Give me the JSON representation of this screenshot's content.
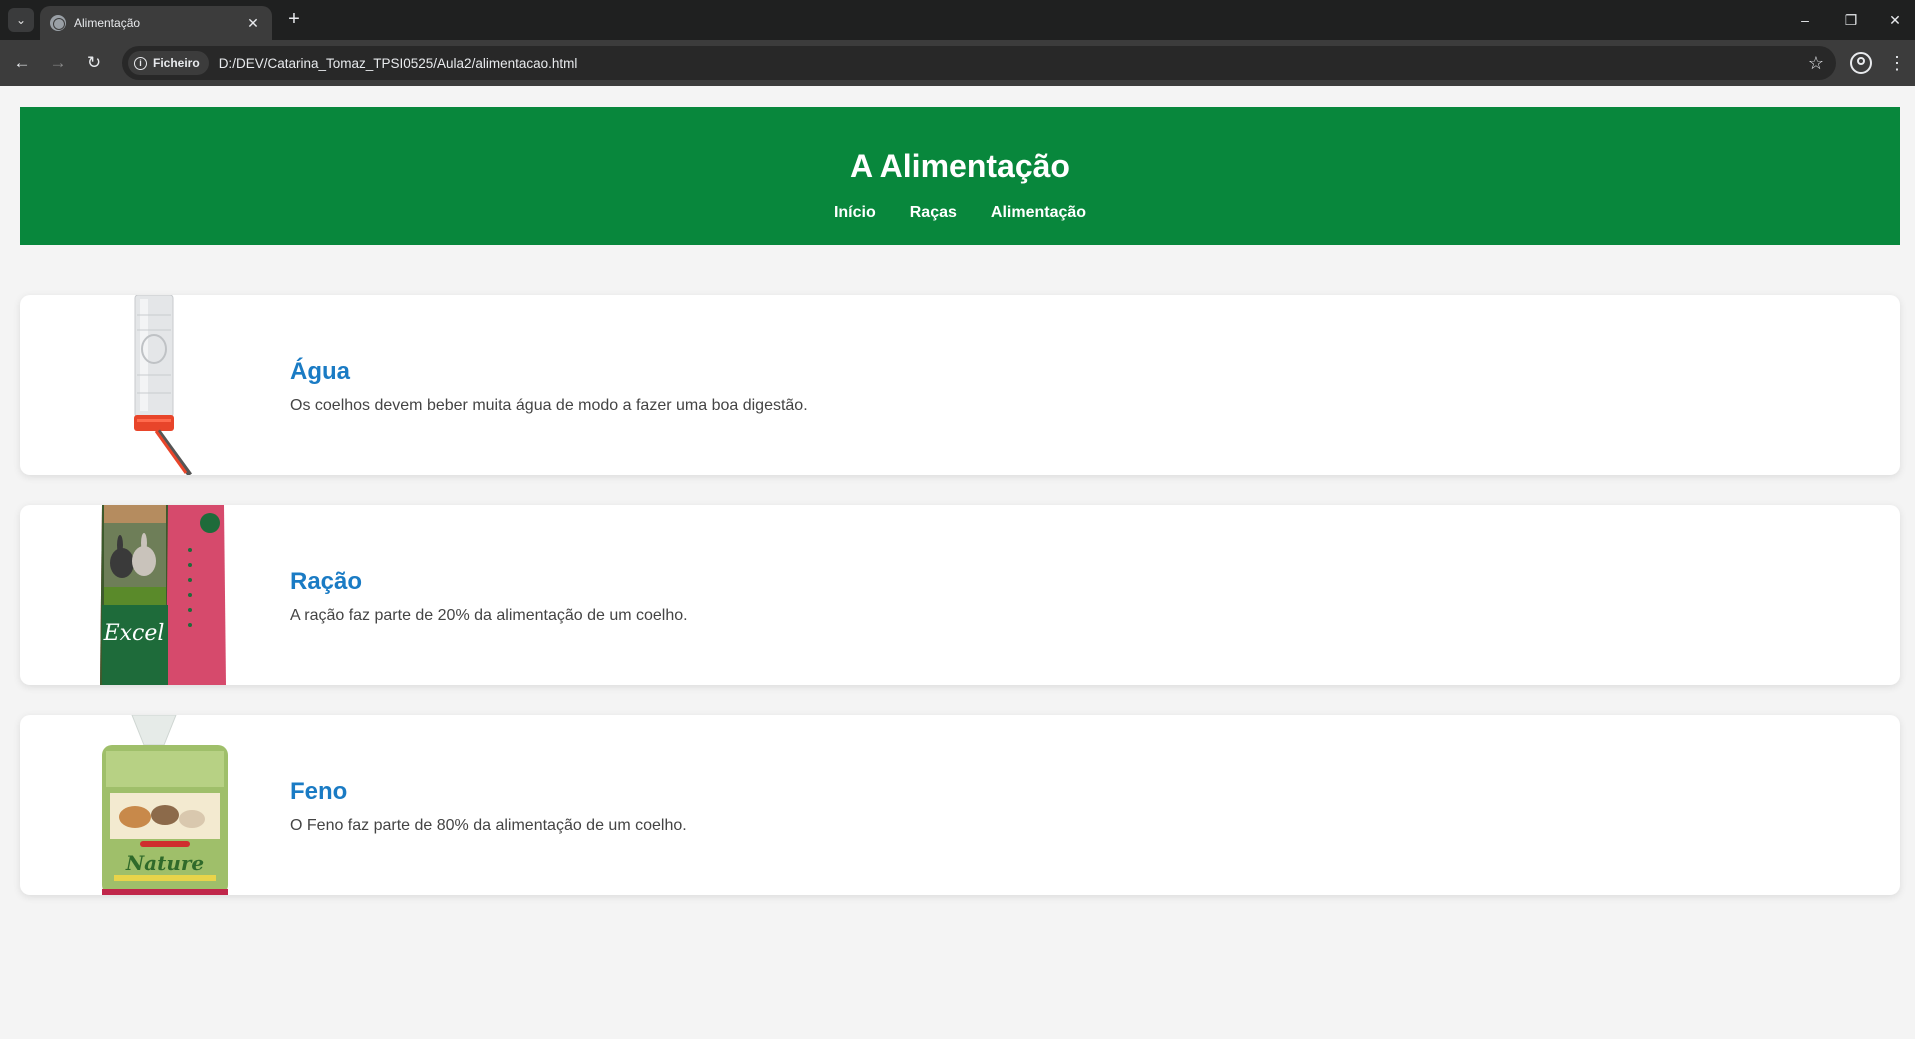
{
  "browser": {
    "tab_title": "Alimentação",
    "address_chip": "Ficheiro",
    "url": "D:/DEV/Catarina_Tomaz_TPSI0525/Aula2/alimentacao.html"
  },
  "header": {
    "title": "A Alimentação",
    "nav": [
      {
        "label": "Início"
      },
      {
        "label": "Raças"
      },
      {
        "label": "Alimentação"
      }
    ]
  },
  "cards": [
    {
      "title": "Água",
      "text": "Os coelhos devem beber muita água de modo a fazer uma boa digestão.",
      "image": "water-bottle"
    },
    {
      "title": "Ração",
      "text": "A ração faz parte de 20% da alimentação de um coelho.",
      "image": "feed-bag",
      "image_brand": "Excel"
    },
    {
      "title": "Feno",
      "text": "O Feno faz parte de 80% da alimentação de um coelho.",
      "image": "hay-bag",
      "image_brand": "Nature"
    }
  ]
}
